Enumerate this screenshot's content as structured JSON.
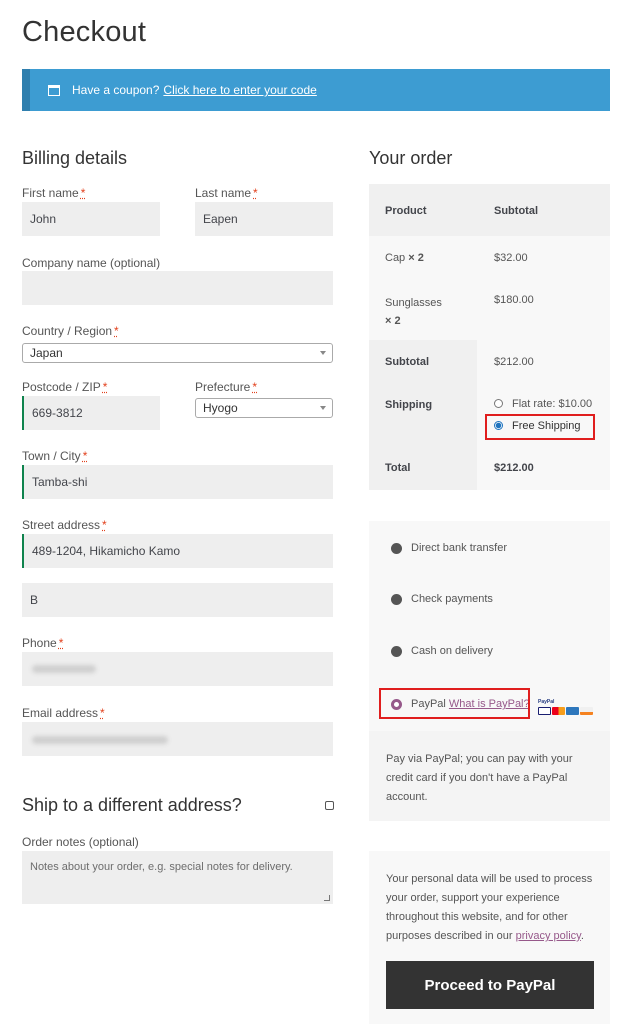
{
  "page": {
    "title": "Checkout"
  },
  "coupon": {
    "text": "Have a coupon?",
    "link": "Click here to enter your code"
  },
  "billing": {
    "heading": "Billing details",
    "first_name_label": "First name",
    "first_name_value": "John",
    "last_name_label": "Last name",
    "last_name_value": "Eapen",
    "company_label": "Company name (optional)",
    "company_value": "",
    "country_label": "Country / Region",
    "country_value": "Japan",
    "postcode_label": "Postcode / ZIP",
    "postcode_value": "669-3812",
    "prefecture_label": "Prefecture",
    "prefecture_value": "Hyogo",
    "town_label": "Town / City",
    "town_value": "Tamba-shi",
    "street_label": "Street address",
    "street_value_1": "489-1204, Hikamicho Kamo",
    "street_value_2": "B",
    "phone_label": "Phone",
    "email_label": "Email address",
    "required_mark": "*"
  },
  "ship_different": {
    "label": "Ship to a different address?"
  },
  "order_notes": {
    "label": "Order notes (optional)",
    "placeholder": "Notes about your order, e.g. special notes for delivery."
  },
  "order": {
    "heading": "Your order",
    "col_product": "Product",
    "col_subtotal": "Subtotal",
    "items": [
      {
        "name": "Cap",
        "qty": "× 2",
        "price": "$32.00"
      },
      {
        "name": "Sunglasses",
        "qty": "× 2",
        "price": "$180.00"
      }
    ],
    "subtotal_label": "Subtotal",
    "subtotal_value": "$212.00",
    "shipping_label": "Shipping",
    "shipping_options": [
      {
        "label": "Flat rate: $10.00",
        "selected": false
      },
      {
        "label": "Free Shipping",
        "selected": true
      }
    ],
    "total_label": "Total",
    "total_value": "$212.00"
  },
  "payment": {
    "methods": [
      {
        "label": "Direct bank transfer"
      },
      {
        "label": "Check payments"
      },
      {
        "label": "Cash on delivery"
      },
      {
        "label": "PayPal",
        "link": "What is PayPal?",
        "selected": true
      }
    ],
    "paypal_logo_text": "PayPal",
    "paypal_description": "Pay via PayPal; you can pay with your credit card if you don't have a PayPal account.",
    "privacy_text": "Your personal data will be used to process your order, support your experience throughout this website, and for other purposes described in our",
    "privacy_link": "privacy policy",
    "privacy_end": ".",
    "proceed_label": "Proceed to PayPal"
  },
  "colors": {
    "coupon_bg": "#3d9cd2",
    "accent": "#96588a",
    "highlight": "#e01e1e",
    "button": "#333333"
  }
}
